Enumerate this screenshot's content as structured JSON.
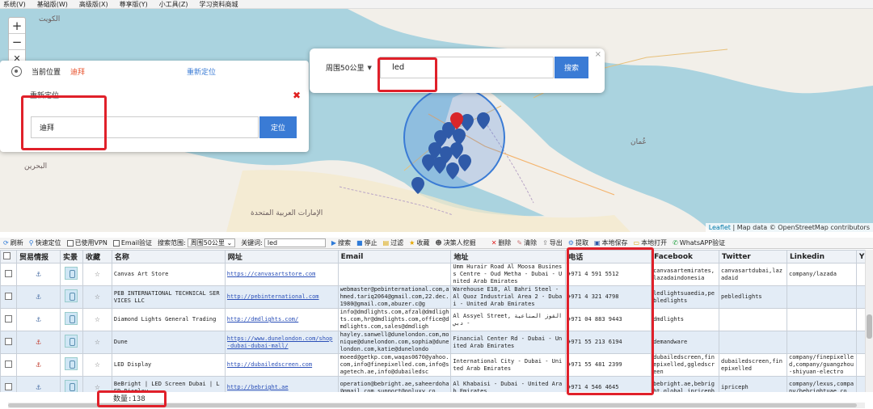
{
  "menu": [
    "系统(V)",
    "基础版(W)",
    "高级版(X)",
    "尊享版(Y)",
    "小工具(Z)",
    "学习资料商城"
  ],
  "map": {
    "attribution_leaflet": "Leaflet",
    "attribution_rest": " | Map data © OpenStreetMap contributors",
    "labels": {
      "uae_ar": "الإمارات العربية المتحدة",
      "oman_ar": "عُمان",
      "kuwait_ar": "الكويت",
      "bahrain_ar": "البحرين"
    }
  },
  "locator": {
    "current_label": "当前位置",
    "city": "迪拜",
    "relocate_link": "重新定位",
    "relocate_title": "重新定位",
    "input_value": "迪拜",
    "locate_button": "定位"
  },
  "search": {
    "range": "周围50公里",
    "keyword": "led",
    "button": "搜索",
    "close": "×"
  },
  "toolbar": {
    "refresh": "刷新",
    "quick_locate": "快速定位",
    "vpn": "已使用VPN",
    "email_verify": "Email验证",
    "range_label": "搜索范围:",
    "range_value": "周围50公里",
    "keyword_label": "关键词:",
    "keyword_value": "led",
    "search": "搜索",
    "stop": "停止",
    "filter": "过滤",
    "favorite": "收藏",
    "decision_maker": "决策人挖掘",
    "delete": "删除",
    "clear": "清除",
    "export": "导出",
    "extract": "提取",
    "save_local": "本地保存",
    "open_local": "本地打开",
    "whatsapp": "WhatsAPP验证"
  },
  "columns": [
    "",
    "贸易情报",
    "实景",
    "收藏",
    "名称",
    "网址",
    "Email",
    "地址",
    "电话",
    "Facebook",
    "Twitter",
    "Linkedin",
    "Y"
  ],
  "rows": [
    {
      "name": "Canvas Art Store",
      "url": "https://canvasartstore.com",
      "email": "",
      "address": "Umm Hurair Road Al Moosa Business Centre - Oud Metha - Dubai - United Arab Emirates",
      "phone": "+971 4 591 5512",
      "facebook": "canvasartemirates,lazadaindonesia",
      "twitter": "canvasartdubai,lazadaid",
      "linkedin": "company/lazada",
      "anchor": "blue"
    },
    {
      "name": "PEB INTERNATIONAL TECHNICAL SERVICES LLC",
      "url": "http://pebinternational.com",
      "email": "webmaster@pebinternational.com,ahmed.tariq2064@gmail.com,22.dec.1980@gmail.com,abuzer.c@g",
      "address": "Warehouse E18, Al Bahri Steel - Al Quoz Industrial Area 2 - Dubai - United Arab Emirates",
      "phone": "+971 4 321 4798",
      "facebook": "ledlightsuaedia,pebledlights",
      "twitter": "pebledlights",
      "linkedin": "",
      "anchor": "blue"
    },
    {
      "name": "Diamond Lights General Trading",
      "url": "http://dmdlights.com/",
      "email": "info@dmdlights.com,afzal@dmdlights.com,hr@dmdlights.com,office@dmdlights.com,sales@dmdligh",
      "address": "Al Assyel Street, القوز الصناعية - دبي",
      "phone": "+971 04 883 9443",
      "facebook": "dmdlights",
      "twitter": "",
      "linkedin": "",
      "anchor": "blue"
    },
    {
      "name": "Dune",
      "url": "https://www.dunelondon.com/shop-dubai-dubai-mall/",
      "email": "hayley.sanwell@dunelondon.com,monique@dunelondon.com,sophia@dunelondon.com,katie@dunelondo",
      "address": "Financial Center Rd - Dubai - United Arab Emirates",
      "phone": "+971 55 213 6194",
      "facebook": "demandware",
      "twitter": "",
      "linkedin": "",
      "anchor": "red"
    },
    {
      "name": "LED Display",
      "url": "http://dubailedscreen.com",
      "email": "moeed@getkp.com,waqas0670@yahoo.com,info@finepixelled.com,info@sagetech.ae,info@dubailedsc",
      "address": "International City - Dubai - United Arab Emirates",
      "phone": "+971 55 481 2399",
      "facebook": "dubailedscreen,finepixelled,ggledscreen",
      "twitter": "dubailedscreen,finepixelled",
      "linkedin": "company/finepixelled,company/guangzhou-shiyuan-electro",
      "anchor": "red"
    },
    {
      "name": "BeBright | LED Screen Dubai | LED Display",
      "url": "http://bebright.ae",
      "email": "operation@bebright.ae,saheerdoha@gmail.com,support@onluxy.co",
      "address": "Al Khabaisi - Dubai - United Arab Emirates",
      "phone": "+971 4 546 4645",
      "facebook": "bebright.ae,bebright.global,ipriceph",
      "twitter": "ipriceph",
      "linkedin": "company/lexus,company/bebrightuae,co",
      "anchor": "blue"
    }
  ],
  "status": {
    "count": "数量:138"
  }
}
